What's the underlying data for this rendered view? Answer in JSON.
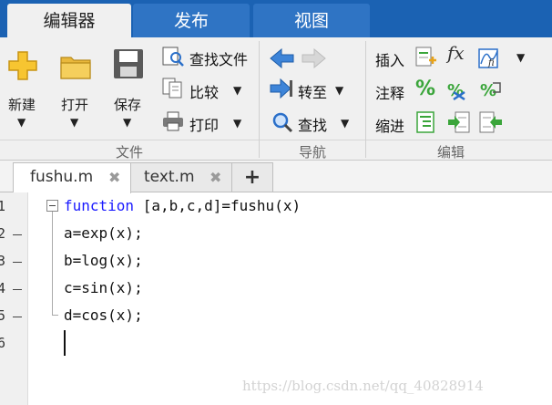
{
  "ribbon_tabs": [
    {
      "label": "编辑器",
      "active": true
    },
    {
      "label": "发布",
      "active": false
    },
    {
      "label": "视图",
      "active": false
    }
  ],
  "file_group": {
    "label": "文件",
    "new_label": "新建",
    "open_label": "打开",
    "save_label": "保存",
    "find_files_label": "查找文件",
    "compare_label": "比较",
    "print_label": "打印"
  },
  "nav_group": {
    "label": "导航",
    "goto_label": "转至",
    "find_label": "查找"
  },
  "edit_group": {
    "label": "编辑",
    "insert_label": "插入",
    "comment_label": "注释",
    "indent_label": "缩进",
    "fx_label": "fx"
  },
  "editor_tabs": [
    {
      "label": "fushu.m",
      "active": true
    },
    {
      "label": "text.m",
      "active": false
    }
  ],
  "add_tab_label": "+",
  "line_numbers": [
    "1",
    "2",
    "3",
    "4",
    "5",
    "6"
  ],
  "code": {
    "line1_keyword": "function",
    "line1_rest": " [a,b,c,d]=fushu(x)",
    "line2": "a=exp(x);",
    "line3": "b=log(x);",
    "line4": "c=sin(x);",
    "line5": "d=cos(x);"
  },
  "watermark": "https://blog.csdn.net/qq_40828914",
  "colors": {
    "ribbon_blue": "#1b62b3",
    "keyword_blue": "#1a1aff",
    "accent_green": "#3aa53a",
    "arrow_blue": "#2a6fc9"
  }
}
